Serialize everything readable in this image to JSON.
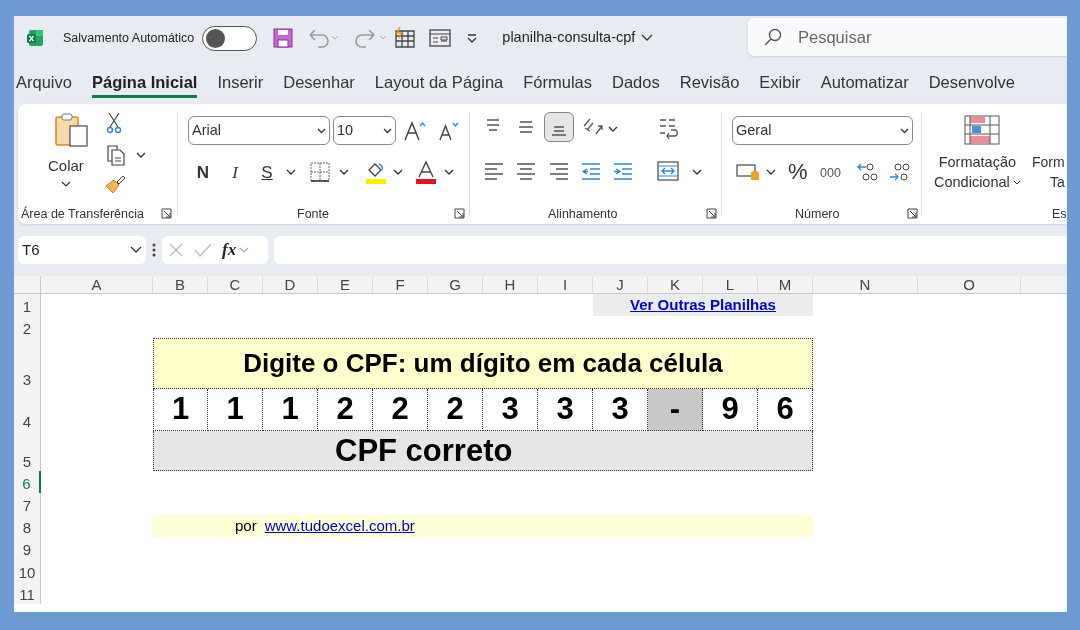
{
  "title_bar": {
    "autosave_label": "Salvamento Automático",
    "autosave_on": false,
    "filename": "planilha-consulta-cpf",
    "search_placeholder": "Pesquisar"
  },
  "tabs": [
    {
      "label": "Arquivo",
      "selected": false
    },
    {
      "label": "Página Inicial",
      "selected": true
    },
    {
      "label": "Inserir",
      "selected": false
    },
    {
      "label": "Desenhar",
      "selected": false
    },
    {
      "label": "Layout da Página",
      "selected": false
    },
    {
      "label": "Fórmulas",
      "selected": false
    },
    {
      "label": "Dados",
      "selected": false
    },
    {
      "label": "Revisão",
      "selected": false
    },
    {
      "label": "Exibir",
      "selected": false
    },
    {
      "label": "Automatizar",
      "selected": false
    },
    {
      "label": "Desenvolve",
      "selected": false
    }
  ],
  "ribbon": {
    "clipboard": {
      "paste_label": "Colar",
      "group_label": "Área de Transferência"
    },
    "font": {
      "font_name": "Arial",
      "font_size": "10",
      "bold": "N",
      "italic": "I",
      "underline": "S",
      "group_label": "Fonte"
    },
    "alignment": {
      "vertical_align": [
        {
          "selected": false
        },
        {
          "selected": false
        },
        {
          "selected": true
        }
      ],
      "group_label": "Alinhamento"
    },
    "number": {
      "format": "Geral",
      "percent": "%",
      "thousands": "000",
      "group_label": "Número"
    },
    "styles": {
      "conditional_line1": "Formatação",
      "conditional_line2": "Condicional",
      "next_line1": "Form",
      "next_line2": "Ta",
      "group_label": "Es"
    }
  },
  "formula_bar": {
    "name_box": "T6",
    "fx": "fx"
  },
  "sheet": {
    "columns": [
      "A",
      "B",
      "C",
      "D",
      "E",
      "F",
      "G",
      "H",
      "I",
      "J",
      "K",
      "L",
      "M",
      "N",
      "O"
    ],
    "rows": [
      {
        "label": "1",
        "selected": false,
        "kind": "link",
        "text": "Ver Outras Planilhas"
      },
      {
        "label": "2",
        "selected": false
      },
      {
        "label": "3",
        "selected": false,
        "kind": "title",
        "text": "Digite o CPF: um dígito em cada célula"
      },
      {
        "label": "4",
        "selected": false,
        "kind": "digits",
        "cells": [
          {
            "text": "1",
            "kind": "digit"
          },
          {
            "text": "1",
            "kind": "digit"
          },
          {
            "text": "1",
            "kind": "digit"
          },
          {
            "text": "2",
            "kind": "digit"
          },
          {
            "text": "2",
            "kind": "digit"
          },
          {
            "text": "2",
            "kind": "digit"
          },
          {
            "text": "3",
            "kind": "digit"
          },
          {
            "text": "3",
            "kind": "digit"
          },
          {
            "text": "3",
            "kind": "digit"
          },
          {
            "text": "-",
            "kind": "separator"
          },
          {
            "text": "9",
            "kind": "digit"
          },
          {
            "text": "6",
            "kind": "digit"
          }
        ]
      },
      {
        "label": "5",
        "selected": false,
        "kind": "result",
        "text": "CPF correto"
      },
      {
        "label": "6",
        "selected": true
      },
      {
        "label": "7",
        "selected": false
      },
      {
        "label": "8",
        "selected": false,
        "kind": "credit",
        "prefix": "por",
        "link": "www.tudoexcel.com.br"
      },
      {
        "label": "9",
        "selected": false
      },
      {
        "label": "10",
        "selected": false
      },
      {
        "label": "11",
        "selected": false
      }
    ]
  }
}
